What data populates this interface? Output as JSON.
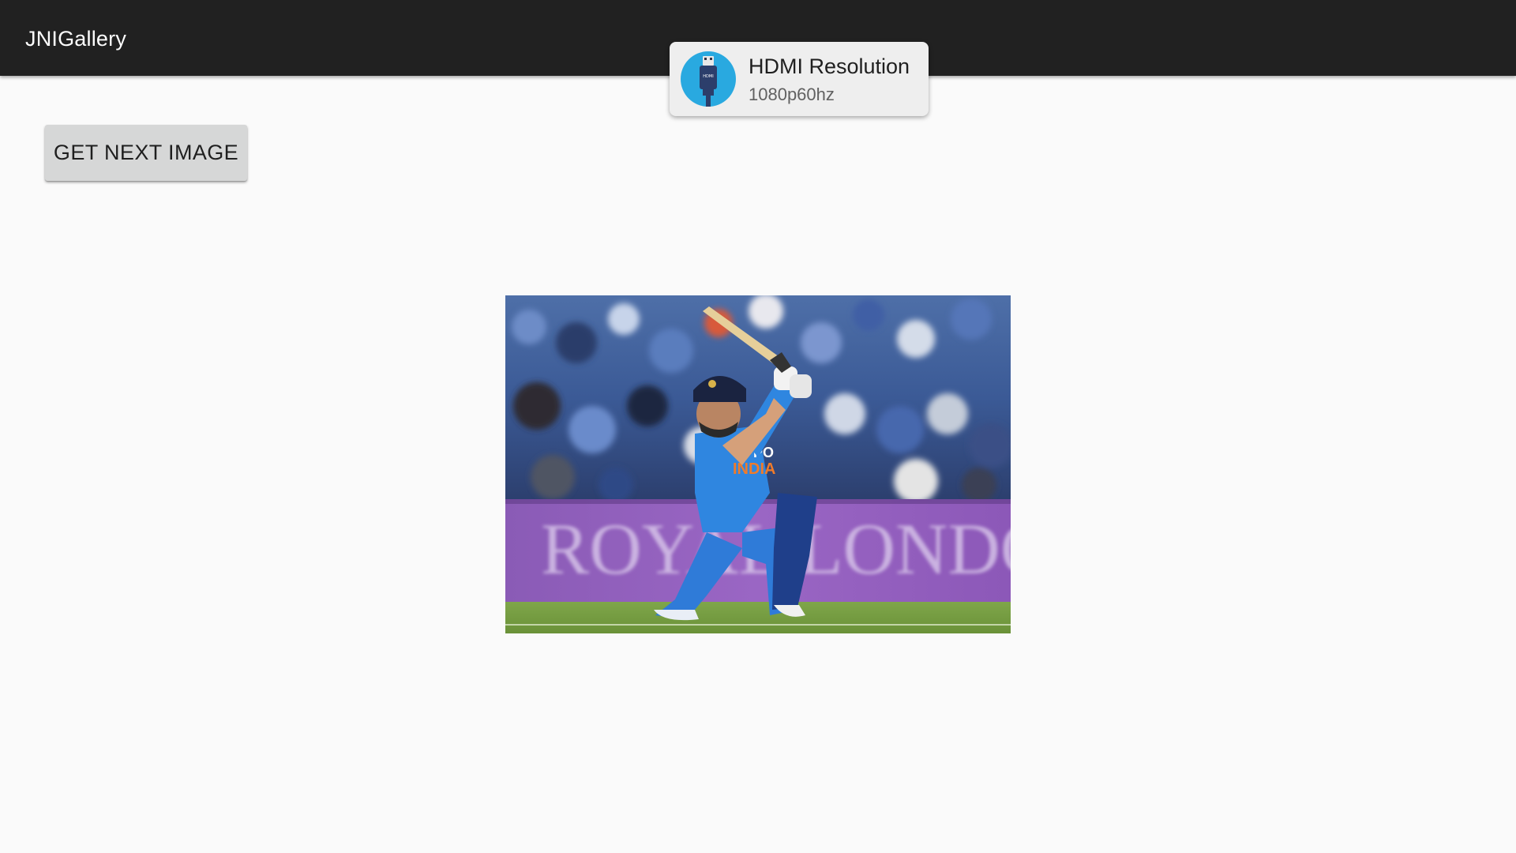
{
  "app_bar": {
    "title": "JNIGallery",
    "background": "#212121"
  },
  "main": {
    "next_button_label": "GET NEXT IMAGE",
    "image": {
      "subject": "cricket batsman in blue India kit playing a shot, stadium crowd behind",
      "jersey_text": [
        "OPPO",
        "INDIA"
      ],
      "boundary_board_text": "ROYAL LONDON"
    }
  },
  "notification": {
    "icon": "hdmi-icon",
    "title": "HDMI Resolution",
    "subtitle": "1080p60hz",
    "icon_color": "#29a9e0"
  }
}
